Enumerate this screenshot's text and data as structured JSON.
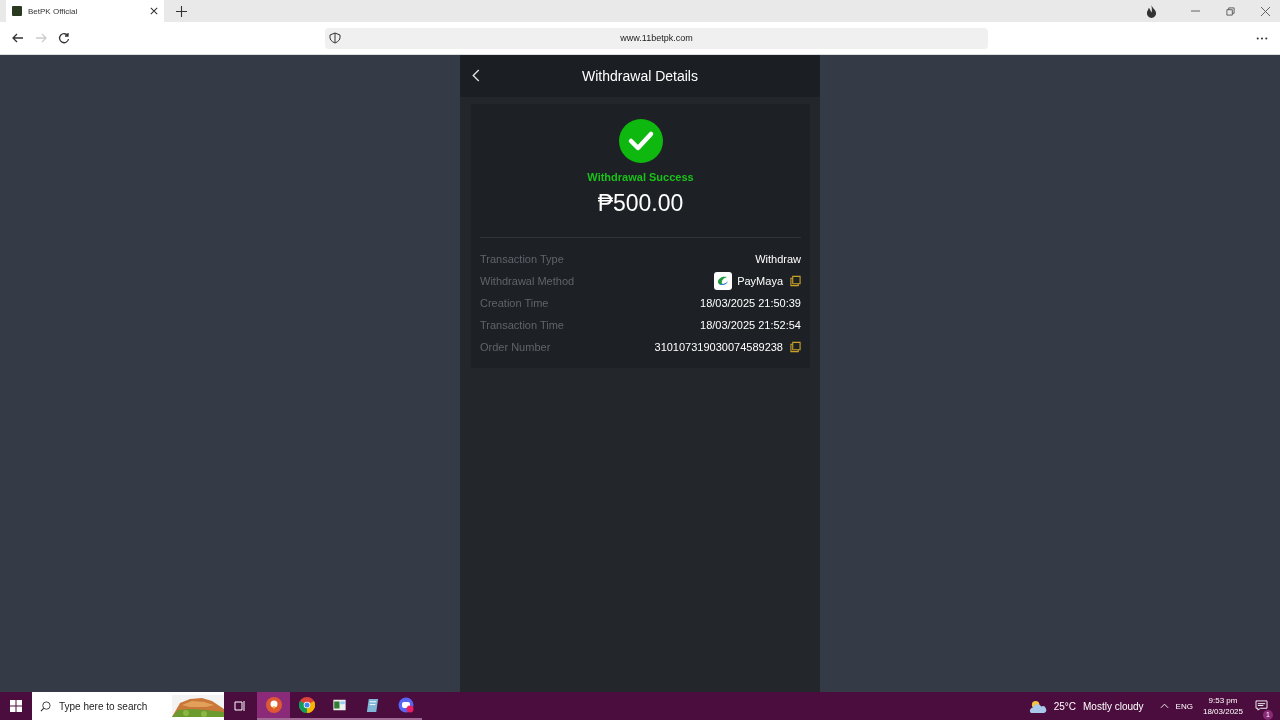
{
  "browser": {
    "tab_title": "BetPK Official",
    "url": "www.11betpk.com"
  },
  "page": {
    "title": "Withdrawal Details",
    "status": "Withdrawal Success",
    "amount": "₱500.00",
    "details": [
      {
        "label": "Transaction Type",
        "value": "Withdraw",
        "kind": "plain"
      },
      {
        "label": "Withdrawal Method",
        "value": "PayMaya",
        "kind": "method"
      },
      {
        "label": "Creation Time",
        "value": "18/03/2025 21:50:39",
        "kind": "plain"
      },
      {
        "label": "Transaction Time",
        "value": "18/03/2025 21:52:54",
        "kind": "plain"
      },
      {
        "label": "Order Number",
        "value": "310107319030074589238",
        "kind": "copy"
      }
    ]
  },
  "taskbar": {
    "search_placeholder": "Type here to search",
    "apps": [
      {
        "kind": "duck",
        "selected": true
      },
      {
        "kind": "chrome",
        "selected": false
      },
      {
        "kind": "window",
        "selected": false
      },
      {
        "kind": "notepad",
        "selected": false
      },
      {
        "kind": "chat",
        "selected": false
      }
    ],
    "temperature": "25°C",
    "weather": "Mostly cloudy",
    "language": "ENG",
    "time": "9:53 pm",
    "date": "18/03/2025",
    "notifications": "1"
  }
}
